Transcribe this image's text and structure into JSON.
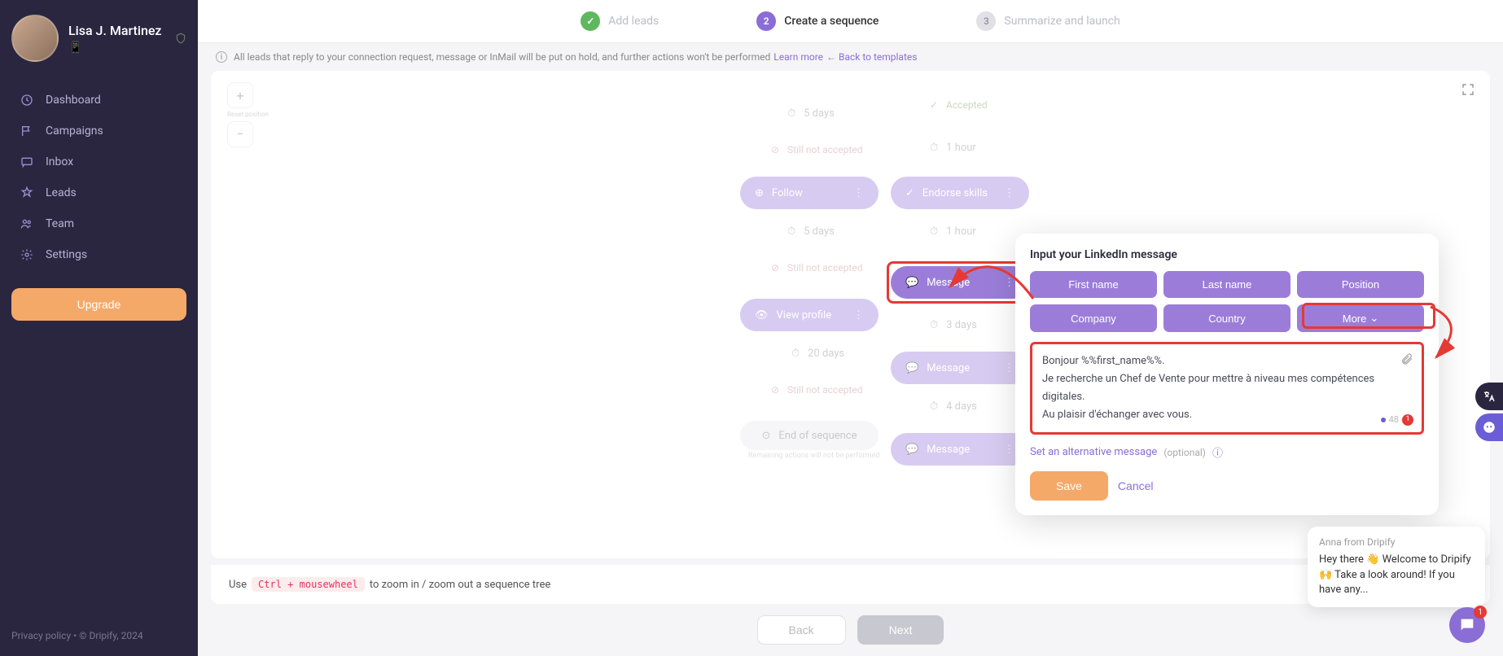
{
  "profile": {
    "name": "Lisa J. Martinez",
    "sub": "📱"
  },
  "nav": {
    "dashboard": "Dashboard",
    "campaigns": "Campaigns",
    "inbox": "Inbox",
    "leads": "Leads",
    "team": "Team",
    "settings": "Settings"
  },
  "upgrade": "Upgrade",
  "footer": {
    "privacy": "Privacy policy",
    "copyright": "© Dripify, 2024"
  },
  "stepper": {
    "step1": "Add leads",
    "step2": "Create a sequence",
    "step2num": "2",
    "step3": "Summarize and launch",
    "step3num": "3"
  },
  "info": {
    "text": "All leads that reply to your connection request, message or InMail will be put on hold, and further actions won't be performed",
    "learn": "Learn more",
    "back": "← Back to templates"
  },
  "zoom": {
    "reset": "Reset position"
  },
  "flow": {
    "delay_5days": "5 days",
    "delay_1hour": "1 hour",
    "accepted": "Accepted",
    "not_accepted": "Still not accepted",
    "follow": "Follow",
    "endorse": "Endorse skills",
    "view_profile": "View profile",
    "delay_3days": "3 days",
    "delay_20days": "20 days",
    "message": "Message",
    "delay_4days": "4 days",
    "end": "End of sequence",
    "end_sub": "Remaining actions will not be performed"
  },
  "popup": {
    "title": "Input your LinkedIn message",
    "vars": {
      "first_name": "First name",
      "last_name": "Last name",
      "position": "Position",
      "company": "Company",
      "country": "Country",
      "more": "More"
    },
    "message_l1": "Bonjour %%first_name%%.",
    "message_l2": "Je recherche un Chef de Vente pour mettre à niveau mes compétences digitales.",
    "message_l3": "Au plaisir d'échanger avec vous.",
    "counter": "48",
    "counter_badge": "1",
    "alt_link": "Set an alternative message",
    "alt_opt": "(optional)",
    "save": "Save",
    "cancel": "Cancel"
  },
  "zoom_hint": {
    "pre": "Use",
    "kbd": "Ctrl + mousewheel",
    "post": "to zoom in / zoom out a sequence tree"
  },
  "bottom": {
    "back": "Back",
    "next": "Next"
  },
  "chat": {
    "from": "Anna from Dripify",
    "msg": "Hey there 👋 Welcome to Dripify 🙌 Take a look around! If you have any...",
    "badge": "1"
  }
}
